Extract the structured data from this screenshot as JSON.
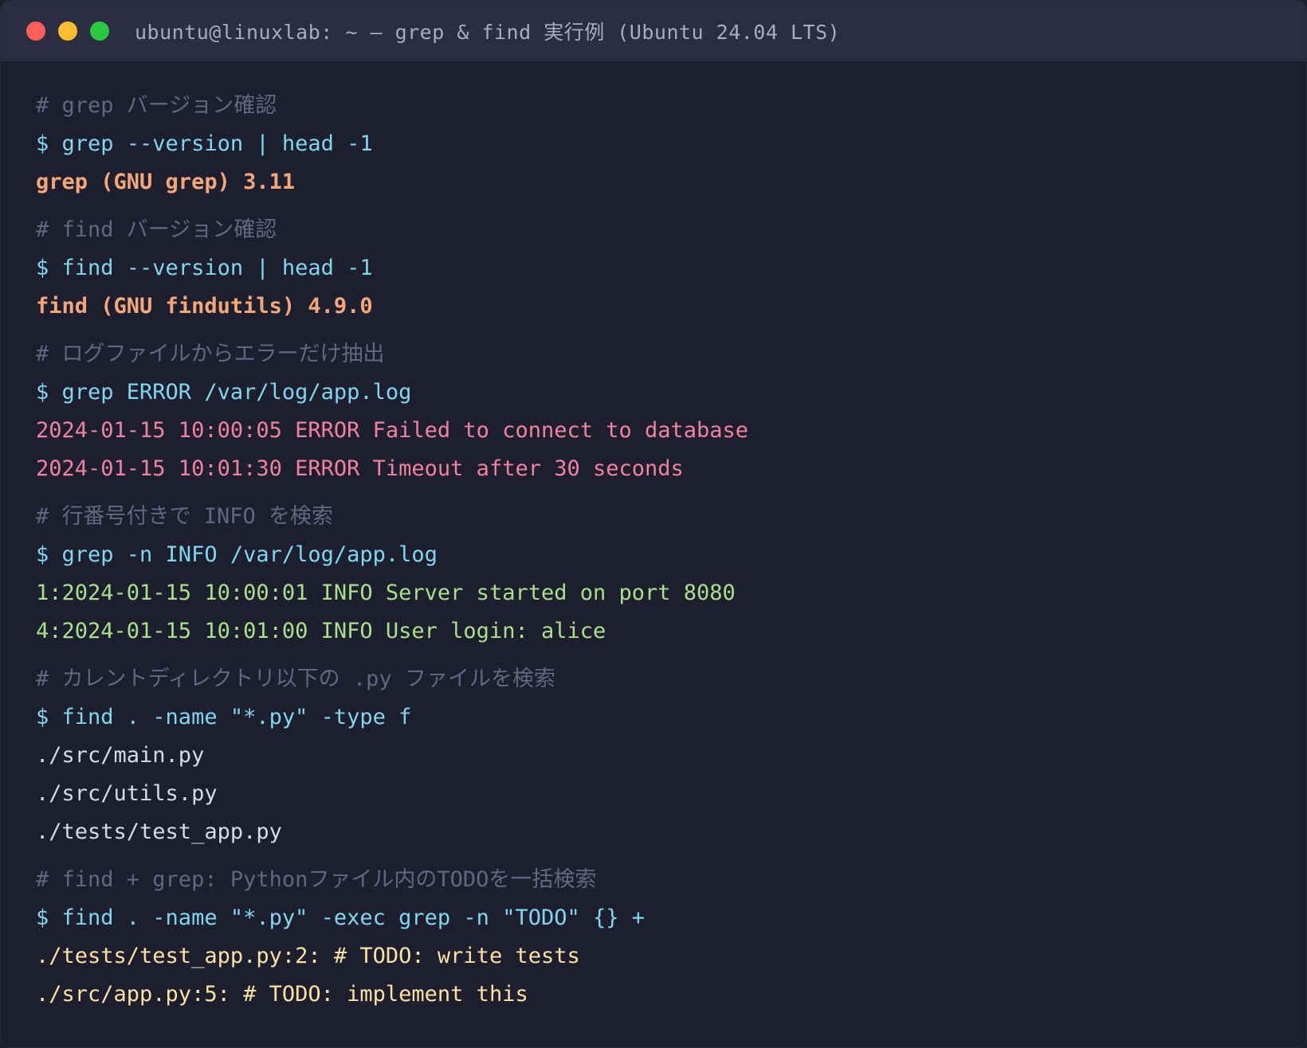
{
  "window": {
    "title": "ubuntu@linuxlab: ~ — grep & find 実行例 (Ubuntu 24.04 LTS)",
    "colors": {
      "background": "#1e1f2e",
      "titlebar": "#2b2d40",
      "close": "#ff5f57",
      "minimize": "#febc2e",
      "maximize": "#28c840"
    }
  },
  "terminal": {
    "blocks": [
      {
        "comment": "# grep バージョン確認",
        "command": "$ grep --version | head -1",
        "output": [
          "grep (GNU grep) 3.11"
        ]
      },
      {
        "comment": "# find バージョン確認",
        "command": "$ find --version | head -1",
        "output": [
          "find (GNU findutils) 4.9.0"
        ]
      },
      {
        "comment": "# ログファイルからエラーだけ抽出",
        "command": "$ grep ERROR /var/log/app.log",
        "output": [
          "2024-01-15 10:00:05 ERROR Failed to connect to database",
          "2024-01-15 10:01:30 ERROR Timeout after 30 seconds"
        ]
      },
      {
        "comment": "# 行番号付きで INFO を検索",
        "command": "$ grep -n INFO /var/log/app.log",
        "output": [
          "1:2024-01-15 10:00:01 INFO Server started on port 8080",
          "4:2024-01-15 10:01:00 INFO User login: alice"
        ]
      },
      {
        "comment": "# カレントディレクトリ以下の .py ファイルを検索",
        "command": "$ find . -name \"*.py\" -type f",
        "output": [
          "./src/main.py",
          "./src/utils.py",
          "./tests/test_app.py"
        ]
      },
      {
        "comment": "# find + grep: Pythonファイル内のTODOを一括検索",
        "command": "$ find . -name \"*.py\" -exec grep -n \"TODO\" {} +",
        "output": [
          "./tests/test_app.py:2: # TODO: write tests",
          "./src/app.py:5: # TODO: implement this"
        ]
      }
    ]
  }
}
